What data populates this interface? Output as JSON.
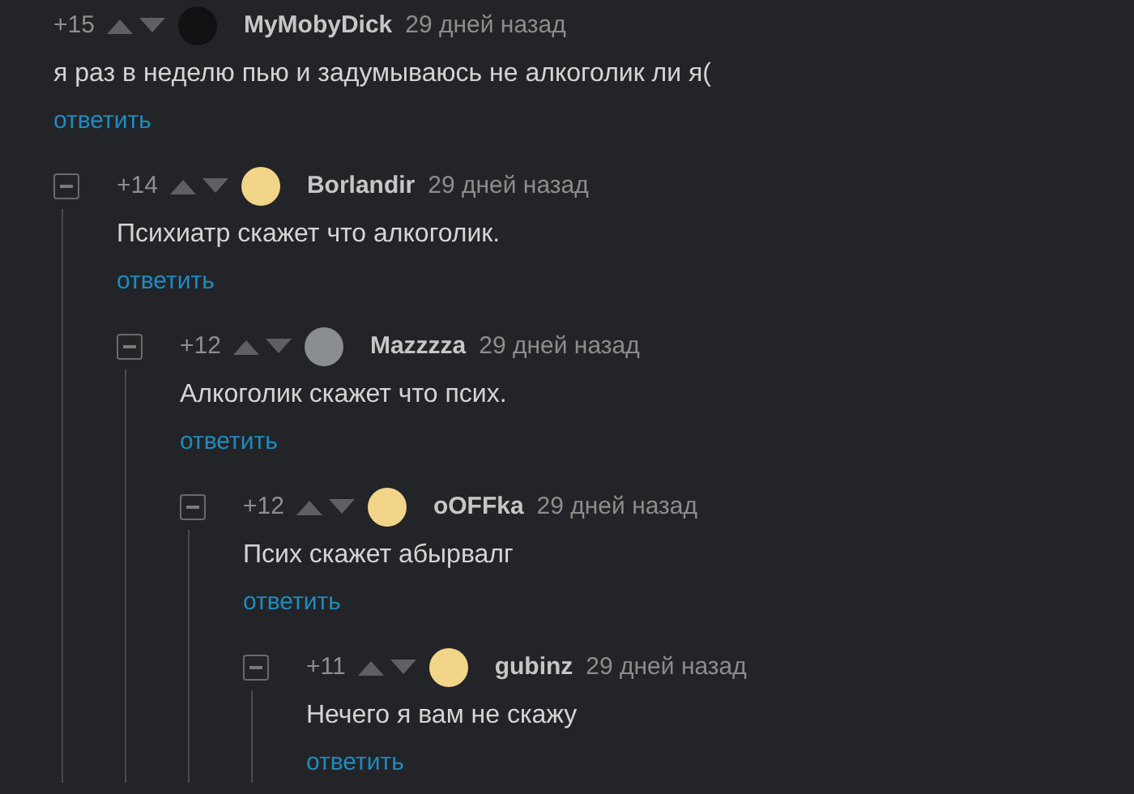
{
  "comment": {
    "score": "+15",
    "author": "MyMobyDick",
    "time": "29 дней назад",
    "avatar": {
      "kind": "dark"
    },
    "text": "я раз в неделю пью и задумываюсь не алкоголик ли я(",
    "reply": "ответить",
    "collapsible": false,
    "children": [
      {
        "score": "+14",
        "author": "Borlandir",
        "time": "29 дней назад",
        "avatar": {
          "kind": "cheese"
        },
        "text": "Психиатр скажет что алкоголик.",
        "reply": "ответить",
        "collapsible": true,
        "children": [
          {
            "score": "+12",
            "author": "Mazzzza",
            "time": "29 дней назад",
            "avatar": {
              "kind": "gray"
            },
            "text": "Алкоголик скажет что псих.",
            "reply": "ответить",
            "collapsible": true,
            "children": [
              {
                "score": "+12",
                "author": "oOFFka",
                "time": "29 дней назад",
                "avatar": {
                  "kind": "cheese"
                },
                "text": "Псих скажет абырвалг",
                "reply": "ответить",
                "collapsible": true,
                "children": [
                  {
                    "score": "+11",
                    "author": "gubinz",
                    "time": "29 дней назад",
                    "avatar": {
                      "kind": "cheese"
                    },
                    "text": "Нечего я вам не скажу",
                    "reply": "ответить",
                    "collapsible": true
                  }
                ]
              }
            ]
          }
        ]
      }
    ]
  }
}
